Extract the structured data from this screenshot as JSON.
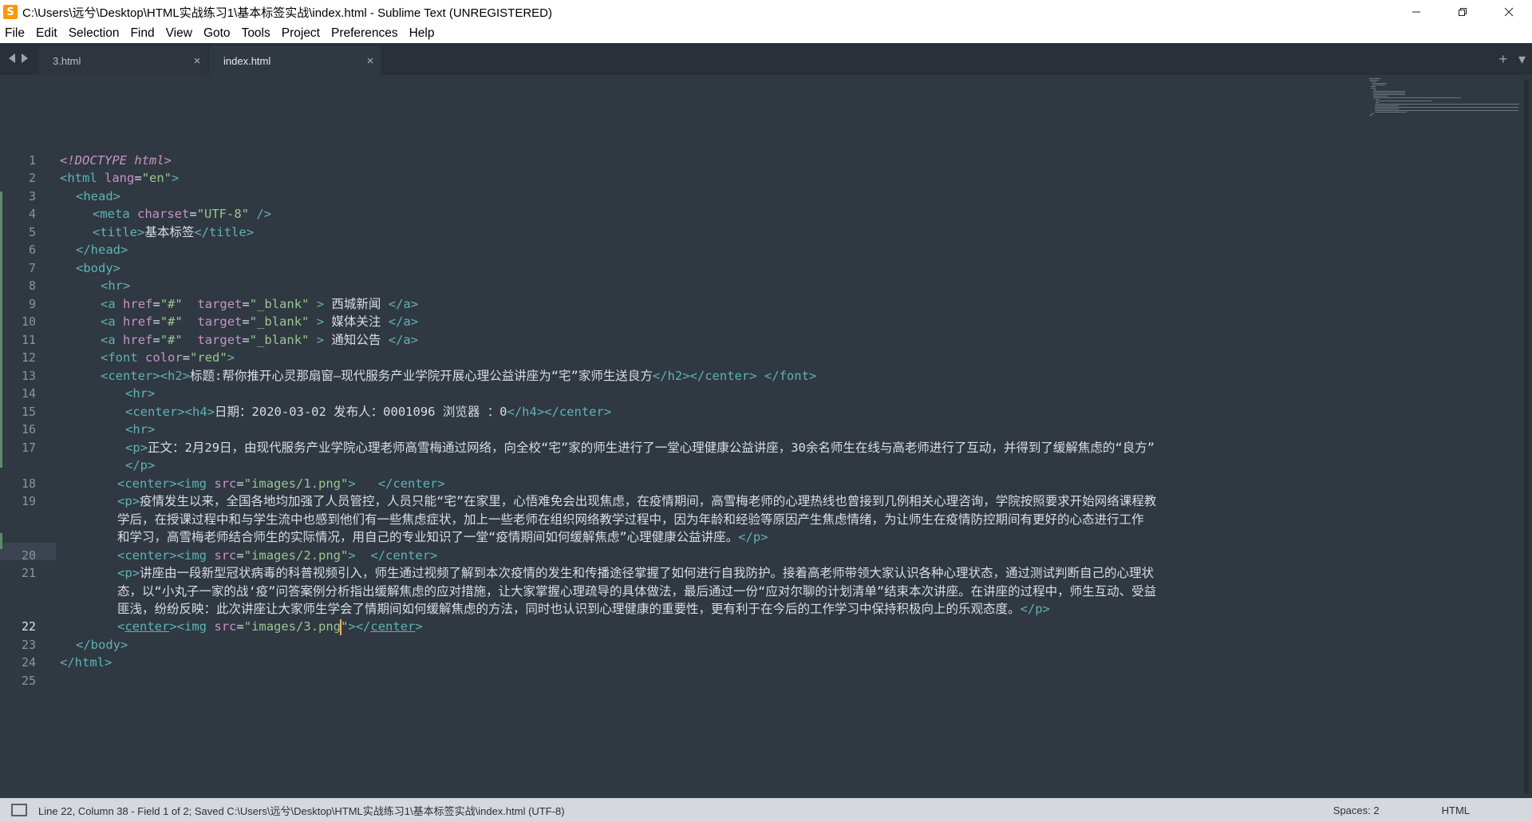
{
  "window": {
    "title": "C:\\Users\\远兮\\Desktop\\HTML实战练习1\\基本标签实战\\index.html - Sublime Text (UNREGISTERED)"
  },
  "menu": [
    "File",
    "Edit",
    "Selection",
    "Find",
    "View",
    "Goto",
    "Tools",
    "Project",
    "Preferences",
    "Help"
  ],
  "tabs": [
    {
      "label": "3.html",
      "active": false
    },
    {
      "label": "index.html",
      "active": true
    }
  ],
  "editor": {
    "current_line": 22,
    "line_numbers": [
      "1",
      "2",
      "3",
      "4",
      "5",
      "6",
      "7",
      "8",
      "9",
      "10",
      "11",
      "12",
      "13",
      "14",
      "15",
      "16",
      "17",
      "18",
      "19",
      "20",
      "21",
      "22",
      "23",
      "24",
      "25"
    ],
    "code": {
      "l1_decl": "<!DOCTYPE html>",
      "l2_html": "html",
      "l2_lang": "lang",
      "l2_lang_val": "\"en\"",
      "l3_head": "head",
      "l4_meta": "meta",
      "l4_charset": "charset",
      "l4_charset_val": "\"UTF-8\"",
      "l5_title": "title",
      "l5_text": "基本标签",
      "l6_head_close": "head",
      "l7_body": "body",
      "l8_hr": "hr",
      "a_tag": "a",
      "a_href": "href",
      "a_href_val": "\"#\"",
      "a_target": "target",
      "a_target_val": "\"_blank\"",
      "l9_text": " 西城新闻 ",
      "l10_text": " 媒体关注 ",
      "l11_text": " 通知公告 ",
      "l12_font": "font",
      "l12_color": "color",
      "l12_color_val": "\"red\"",
      "l13_center": "center",
      "l13_h2": "h2",
      "l13_text": "标题:帮你推开心灵那扇窗—现代服务产业学院开展心理公益讲座为“宅”家师生送良方",
      "l14_hr": "hr",
      "l15_h4": "h4",
      "l15_text": "日期：2020-03-02 发布人：0001096 浏览器 ：0",
      "l16_hr": "hr",
      "p_tag": "p",
      "l17_text": "正文：2月29日，由现代服务产业学院心理老师高雪梅通过网络，向全校“宅”家的师生进行了一堂心理健康公益讲座，30余名师生在线与高老师进行了互动，并得到了缓解焦虑的“良方”",
      "img_tag": "img",
      "img_src": "src",
      "l18_src_val": "\"images/1.png\"",
      "l19_text_a": "疫情发生以来，全国各地均加强了人员管控，人员只能“宅”在家里，心悟难免会出现焦虑，在疫情期间，高雪梅老师的心理热线也曾接到几例相关心理咨询，学院按照要求开始网络课程教",
      "l19_text_b": "学后，在授课过程中和与学生流中也感到他们有一些焦虑症状，加上一些老师在组织网络教学过程中，因为年龄和经验等原因产生焦虑情绪，为让师生在疫情防控期间有更好的心态进行工作",
      "l19_text_c": "和学习，高雪梅老师结合师生的实际情况，用自己的专业知识了一堂“疫情期间如何缓解焦虑”心理健康公益讲座。",
      "l20_src_val": "\"images/2.png\"",
      "l21_text_a": "讲座由一段新型冠状病毒的科普视频引入，师生通过视频了解到本次疫情的发生和传播途径掌握了如何进行自我防护。接着高老师带领大家认识各种心理状态，通过测试判断自己的心理状",
      "l21_text_b": "态，以“小丸子一家的战‘疫”问答案例分析指出缓解焦虑的应对措施，让大家掌握心理疏导的具体做法，最后通过一份“应对尔聊的计划清单”结束本次讲座。在讲座的过程中，师生互动、受益",
      "l21_text_c": "匪浅，纷纷反映：此次讲座让大家师生学会了情期间如何缓解焦虑的方法，同时也认识到心理健康的重要性，更有利于在今后的工作学习中保持积极向上的乐观态度。",
      "l22_src_a": "\"images/3.png",
      "l22_src_b": "\""
    }
  },
  "status": {
    "text": "Line 22, Column 38 - Field 1 of 2; Saved C:\\Users\\远兮\\Desktop\\HTML实战练习1\\基本标签实战\\index.html (UTF-8)",
    "spaces": "Spaces: 2",
    "syntax": "HTML"
  },
  "colors": {
    "background": "#303841",
    "tag": "#5fb3b3",
    "attribute": "#c594c5",
    "string": "#99c794",
    "text": "#d8dee9",
    "caret": "#f9ae58"
  }
}
